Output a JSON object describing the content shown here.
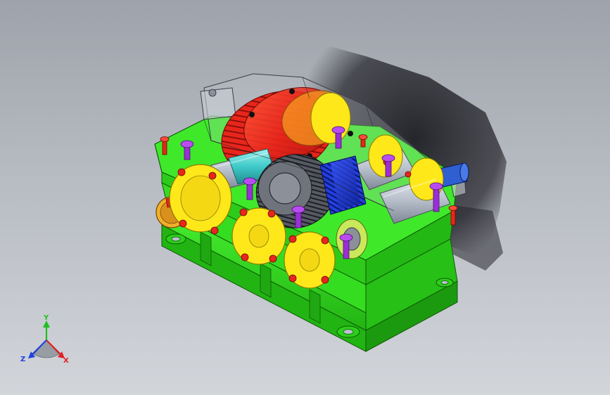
{
  "viewport": {
    "background_top": "#9ea3ab",
    "background_bottom": "#d2d5da",
    "model": {
      "housing_color": "#33e01f",
      "large_gear_color": "#e8261c",
      "gear_dark_color": "#3a3c44",
      "pinion_color": "#1b34c8",
      "flange_color": "#ffe81a",
      "bolt_color": "#9b2fd6",
      "small_bolt_color": "#e8261c",
      "shaft_color": "#d99a18",
      "sleeve_color": "#3ec9c8",
      "shadow_color": "#1e1f24"
    }
  },
  "triad": {
    "x_label": "X",
    "y_label": "Y",
    "z_label": "Z",
    "x_color": "#e02020",
    "y_color": "#20c020",
    "z_color": "#2040e0"
  }
}
